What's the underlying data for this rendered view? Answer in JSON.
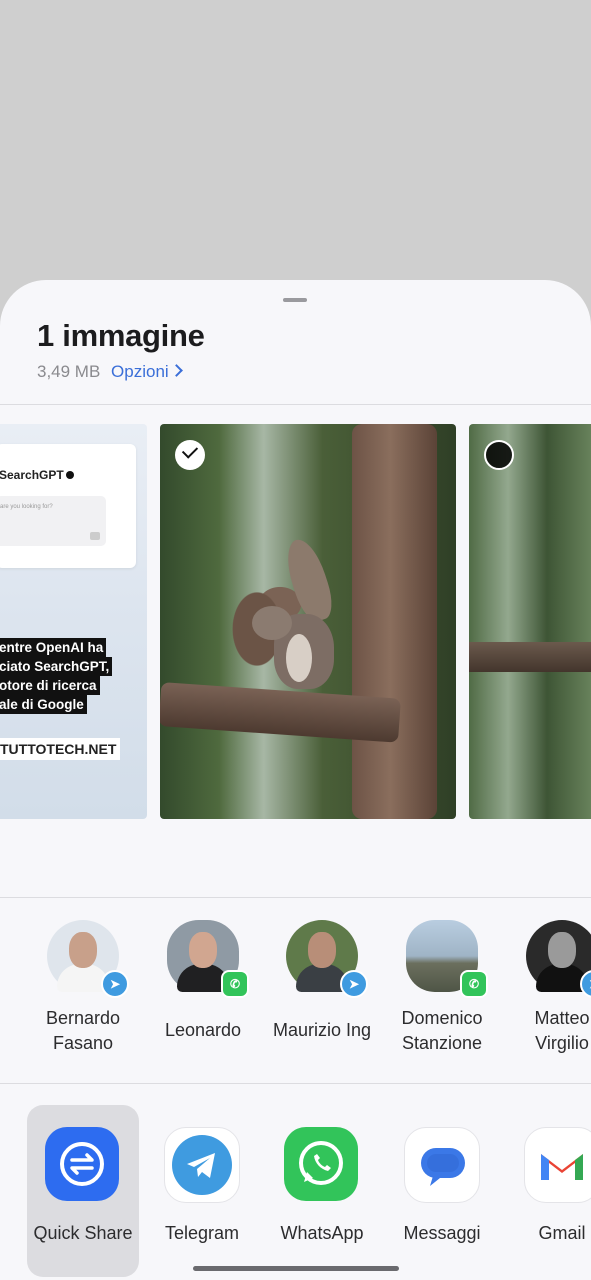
{
  "header": {
    "title": "1 immagine",
    "size": "3,49 MB",
    "options_label": "Opzioni"
  },
  "thumbnail1": {
    "brand": "SearchGPT",
    "placeholder": "are you looking for?",
    "headline": [
      "entre OpenAI ha",
      "ciato SearchGPT,",
      "otore di ricerca",
      "ale di Google"
    ],
    "site": "TUTTOTECH.NET"
  },
  "contacts": [
    {
      "line1": "Bernardo",
      "line2": "Fasano",
      "app": "telegram"
    },
    {
      "line1": "Leonardo",
      "line2": "",
      "app": "whatsapp"
    },
    {
      "line1": "Maurizio Ing",
      "line2": "",
      "app": "telegram"
    },
    {
      "line1": "Domenico",
      "line2": "Stanzione",
      "app": "whatsapp"
    },
    {
      "line1": "Matteo",
      "line2": "Virgilio",
      "app": "telegram"
    }
  ],
  "apps": [
    {
      "label": "Quick Share",
      "icon": "quick-share-icon",
      "color": "#2d6cf0"
    },
    {
      "label": "Telegram",
      "icon": "telegram-icon",
      "color": "#3f9be0"
    },
    {
      "label": "WhatsApp",
      "icon": "whatsapp-icon",
      "color": "#32c45a"
    },
    {
      "label": "Messaggi",
      "icon": "messages-icon",
      "color": "#3b78e7"
    },
    {
      "label": "Gmail",
      "icon": "gmail-icon",
      "color": "#ea4335"
    }
  ]
}
